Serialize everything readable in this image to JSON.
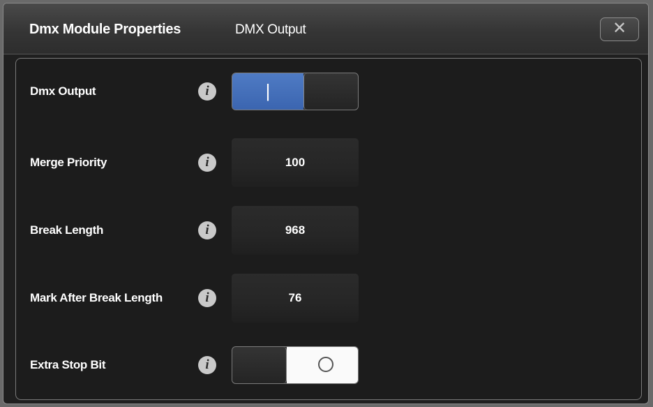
{
  "dialog": {
    "title": "Dmx Module Properties",
    "subtitle": "DMX Output",
    "close_label": "✕"
  },
  "properties": [
    {
      "label": "Dmx Output",
      "type": "toggle",
      "state": "on",
      "toggle_glyph": "|"
    },
    {
      "label": "Merge Priority",
      "type": "value",
      "value": "100"
    },
    {
      "label": "Break Length",
      "type": "value",
      "value": "968"
    },
    {
      "label": "Mark After Break Length",
      "type": "value",
      "value": "76"
    },
    {
      "label": "Extra Stop Bit",
      "type": "toggle",
      "state": "off"
    }
  ],
  "info_glyph": "i",
  "colors": {
    "accent": "#4a74bd",
    "background": "#1f1f1f"
  }
}
